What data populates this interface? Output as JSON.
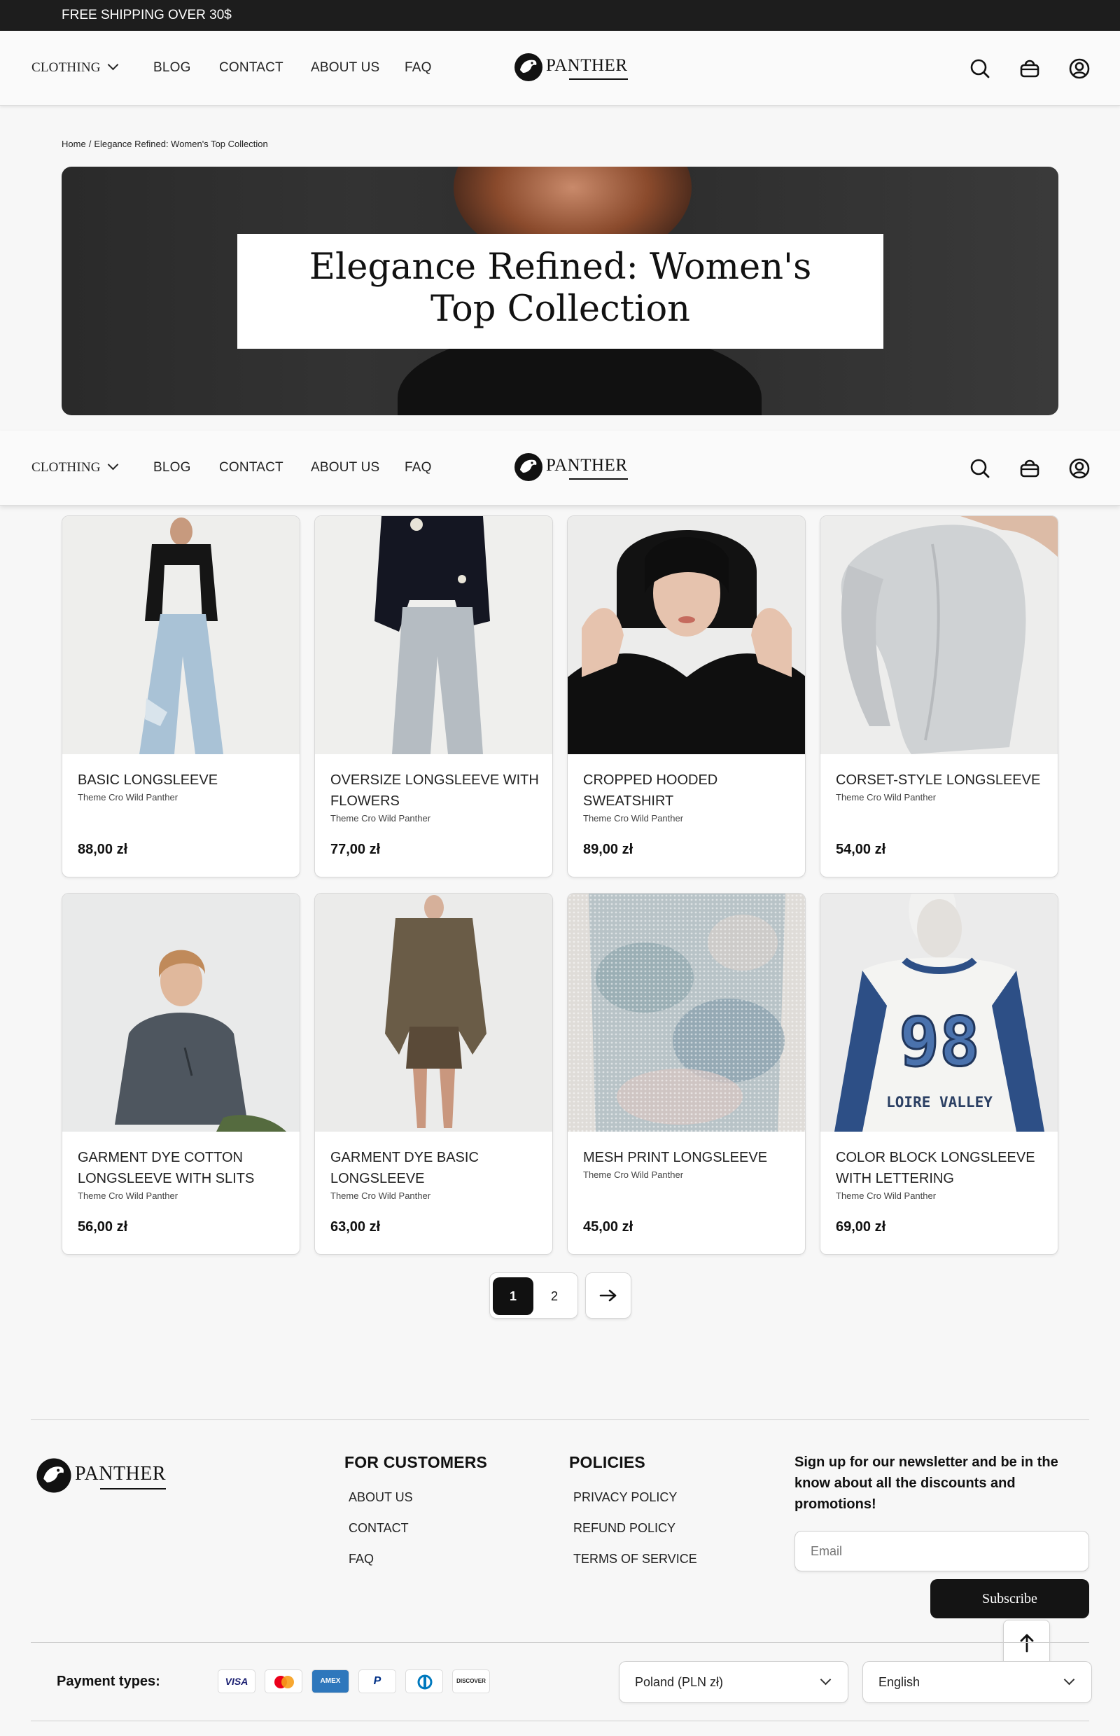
{
  "topbar": {
    "text": "FREE SHIPPING OVER 30$"
  },
  "nav": {
    "clothing": "CLOTHING",
    "blog": "BLOG",
    "contact": "CONTACT",
    "about": "ABOUT US",
    "faq": "FAQ",
    "logo_text": "PANTHER"
  },
  "breadcrumb": {
    "home": "Home",
    "sep": "/",
    "current": "Elegance Refined: Women's Top Collection"
  },
  "hero": {
    "title_line1": "Elegance Refined: Women's",
    "title_line2": "Top Collection"
  },
  "products": [
    {
      "name": "BASIC LONGSLEEVE",
      "brand": "Theme Cro Wild Panther",
      "price": "88,00 zł"
    },
    {
      "name": "OVERSIZE LONGSLEEVE WITH FLOWERS",
      "brand": "Theme Cro Wild Panther",
      "price": "77,00 zł"
    },
    {
      "name": "CROPPED HOODED SWEATSHIRT",
      "brand": "Theme Cro Wild Panther",
      "price": "89,00 zł"
    },
    {
      "name": "CORSET-STYLE LONGSLEEVE",
      "brand": "Theme Cro Wild Panther",
      "price": "54,00 zł"
    },
    {
      "name": "GARMENT DYE COTTON LONGSLEEVE WITH SLITS",
      "brand": "Theme Cro Wild Panther",
      "price": "56,00 zł"
    },
    {
      "name": "GARMENT DYE BASIC LONGSLEEVE",
      "brand": "Theme Cro Wild Panther",
      "price": "63,00 zł"
    },
    {
      "name": "MESH PRINT LONGSLEEVE",
      "brand": "Theme Cro Wild Panther",
      "price": "45,00 zł"
    },
    {
      "name": "COLOR BLOCK LONGSLEEVE WITH LETTERING",
      "brand": "Theme Cro Wild Panther",
      "price": "69,00 zł"
    }
  ],
  "product_images": [
    {
      "print_top": "",
      "print_bottom": ""
    },
    {
      "print_top": "",
      "print_bottom": ""
    },
    {
      "print_top": "",
      "print_bottom": ""
    },
    {
      "print_top": "",
      "print_bottom": ""
    },
    {
      "print_top": "",
      "print_bottom": ""
    },
    {
      "print_top": "",
      "print_bottom": ""
    },
    {
      "print_top": "",
      "print_bottom": ""
    },
    {
      "print_top": "98",
      "print_bottom": "LOIRE VALLEY"
    }
  ],
  "pagination": {
    "page1": "1",
    "page2": "2",
    "current_page": 1
  },
  "footer": {
    "logo_text": "PANTHER",
    "customers_title": "FOR CUSTOMERS",
    "customers_links": [
      "ABOUT US",
      "CONTACT",
      "FAQ"
    ],
    "policies_title": "POLICIES",
    "policies_links": [
      "PRIVACY POLICY",
      "REFUND POLICY",
      "TERMS OF SERVICE"
    ],
    "newsletter_text": "Sign up for our newsletter and be in the know about all the discounts and promotions!",
    "email_placeholder": "Email",
    "subscribe_label": "Subscribe",
    "payment_label": "Payment types:",
    "payment_methods": [
      "VISA",
      "Mastercard",
      "American Express",
      "PayPal",
      "Diners Club",
      "DISCOVER"
    ],
    "currency_value": "Poland (PLN zł)",
    "language_value": "English"
  },
  "colors": {
    "dark": "#141414",
    "background": "#f7f7f7",
    "card": "#ffffff",
    "accent_blue": "#2d4f86"
  }
}
